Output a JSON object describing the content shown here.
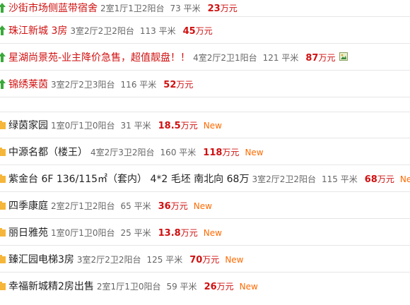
{
  "top_listings": [
    {
      "title": "沙街市场侧蓝带宿舍",
      "title_color": "red",
      "layout": "2室1厅1卫2阳台",
      "area": "73 平米",
      "price": "23",
      "unit": "万元"
    },
    {
      "title": "珠江新城 3房",
      "title_color": "green",
      "layout": "3室2厅2卫2阳台",
      "area": "113 平米",
      "price": "45",
      "unit": "万元"
    },
    {
      "title": "星湖尚景苑-业主降价急售，超值靓盘！！",
      "title_color": "red",
      "layout": "4室2厅2卫1阳台",
      "area": "121 平米",
      "price": "87",
      "unit": "万元",
      "has_pic": true
    },
    {
      "title": "锦绣莱茵",
      "title_color": "red",
      "layout": "3室2厅2卫3阳台",
      "area": "116 平米",
      "price": "52",
      "unit": "万元"
    }
  ],
  "new_listings": [
    {
      "title": "绿茵家园",
      "layout": "1室0厅1卫0阳台",
      "area": "31 平米",
      "price": "18.5",
      "unit": "万元",
      "badge": "New"
    },
    {
      "title": "中源名都（楼王）",
      "layout": "4室2厅3卫2阳台",
      "area": "160 平米",
      "price": "118",
      "unit": "万元",
      "badge": "New"
    },
    {
      "title": "紫金台 6F 136/115㎡（套内） 4*2 毛坯 南北向 68万",
      "layout": "3室2厅2卫2阳台",
      "area": "115 平米",
      "price": "68",
      "unit": "万元",
      "badge": "New"
    },
    {
      "title": "四季康庭",
      "layout": "2室2厅1卫2阳台",
      "area": "65 平米",
      "price": "36",
      "unit": "万元",
      "badge": "New"
    },
    {
      "title": "丽日雅苑",
      "layout": "1室0厅1卫0阳台",
      "area": "25 平米",
      "price": "13.8",
      "unit": "万元",
      "badge": "New"
    },
    {
      "title": "臻汇园电梯3房",
      "layout": "3室2厅2卫2阳台",
      "area": "125 平米",
      "price": "70",
      "unit": "万元",
      "badge": "New"
    },
    {
      "title": "幸福新城精2房出售",
      "layout": "2室1厅1卫0阳台",
      "area": "59 平米",
      "price": "26",
      "unit": "万元",
      "badge": "New"
    }
  ],
  "icons": {
    "top": "green-up-arrow-icon",
    "new": "folder-icon",
    "pic": "photo-icon"
  },
  "colors": {
    "red": "#d01010",
    "green": "#108010",
    "new_badge": "#ff6a00",
    "divider": "#e6e6e6"
  }
}
